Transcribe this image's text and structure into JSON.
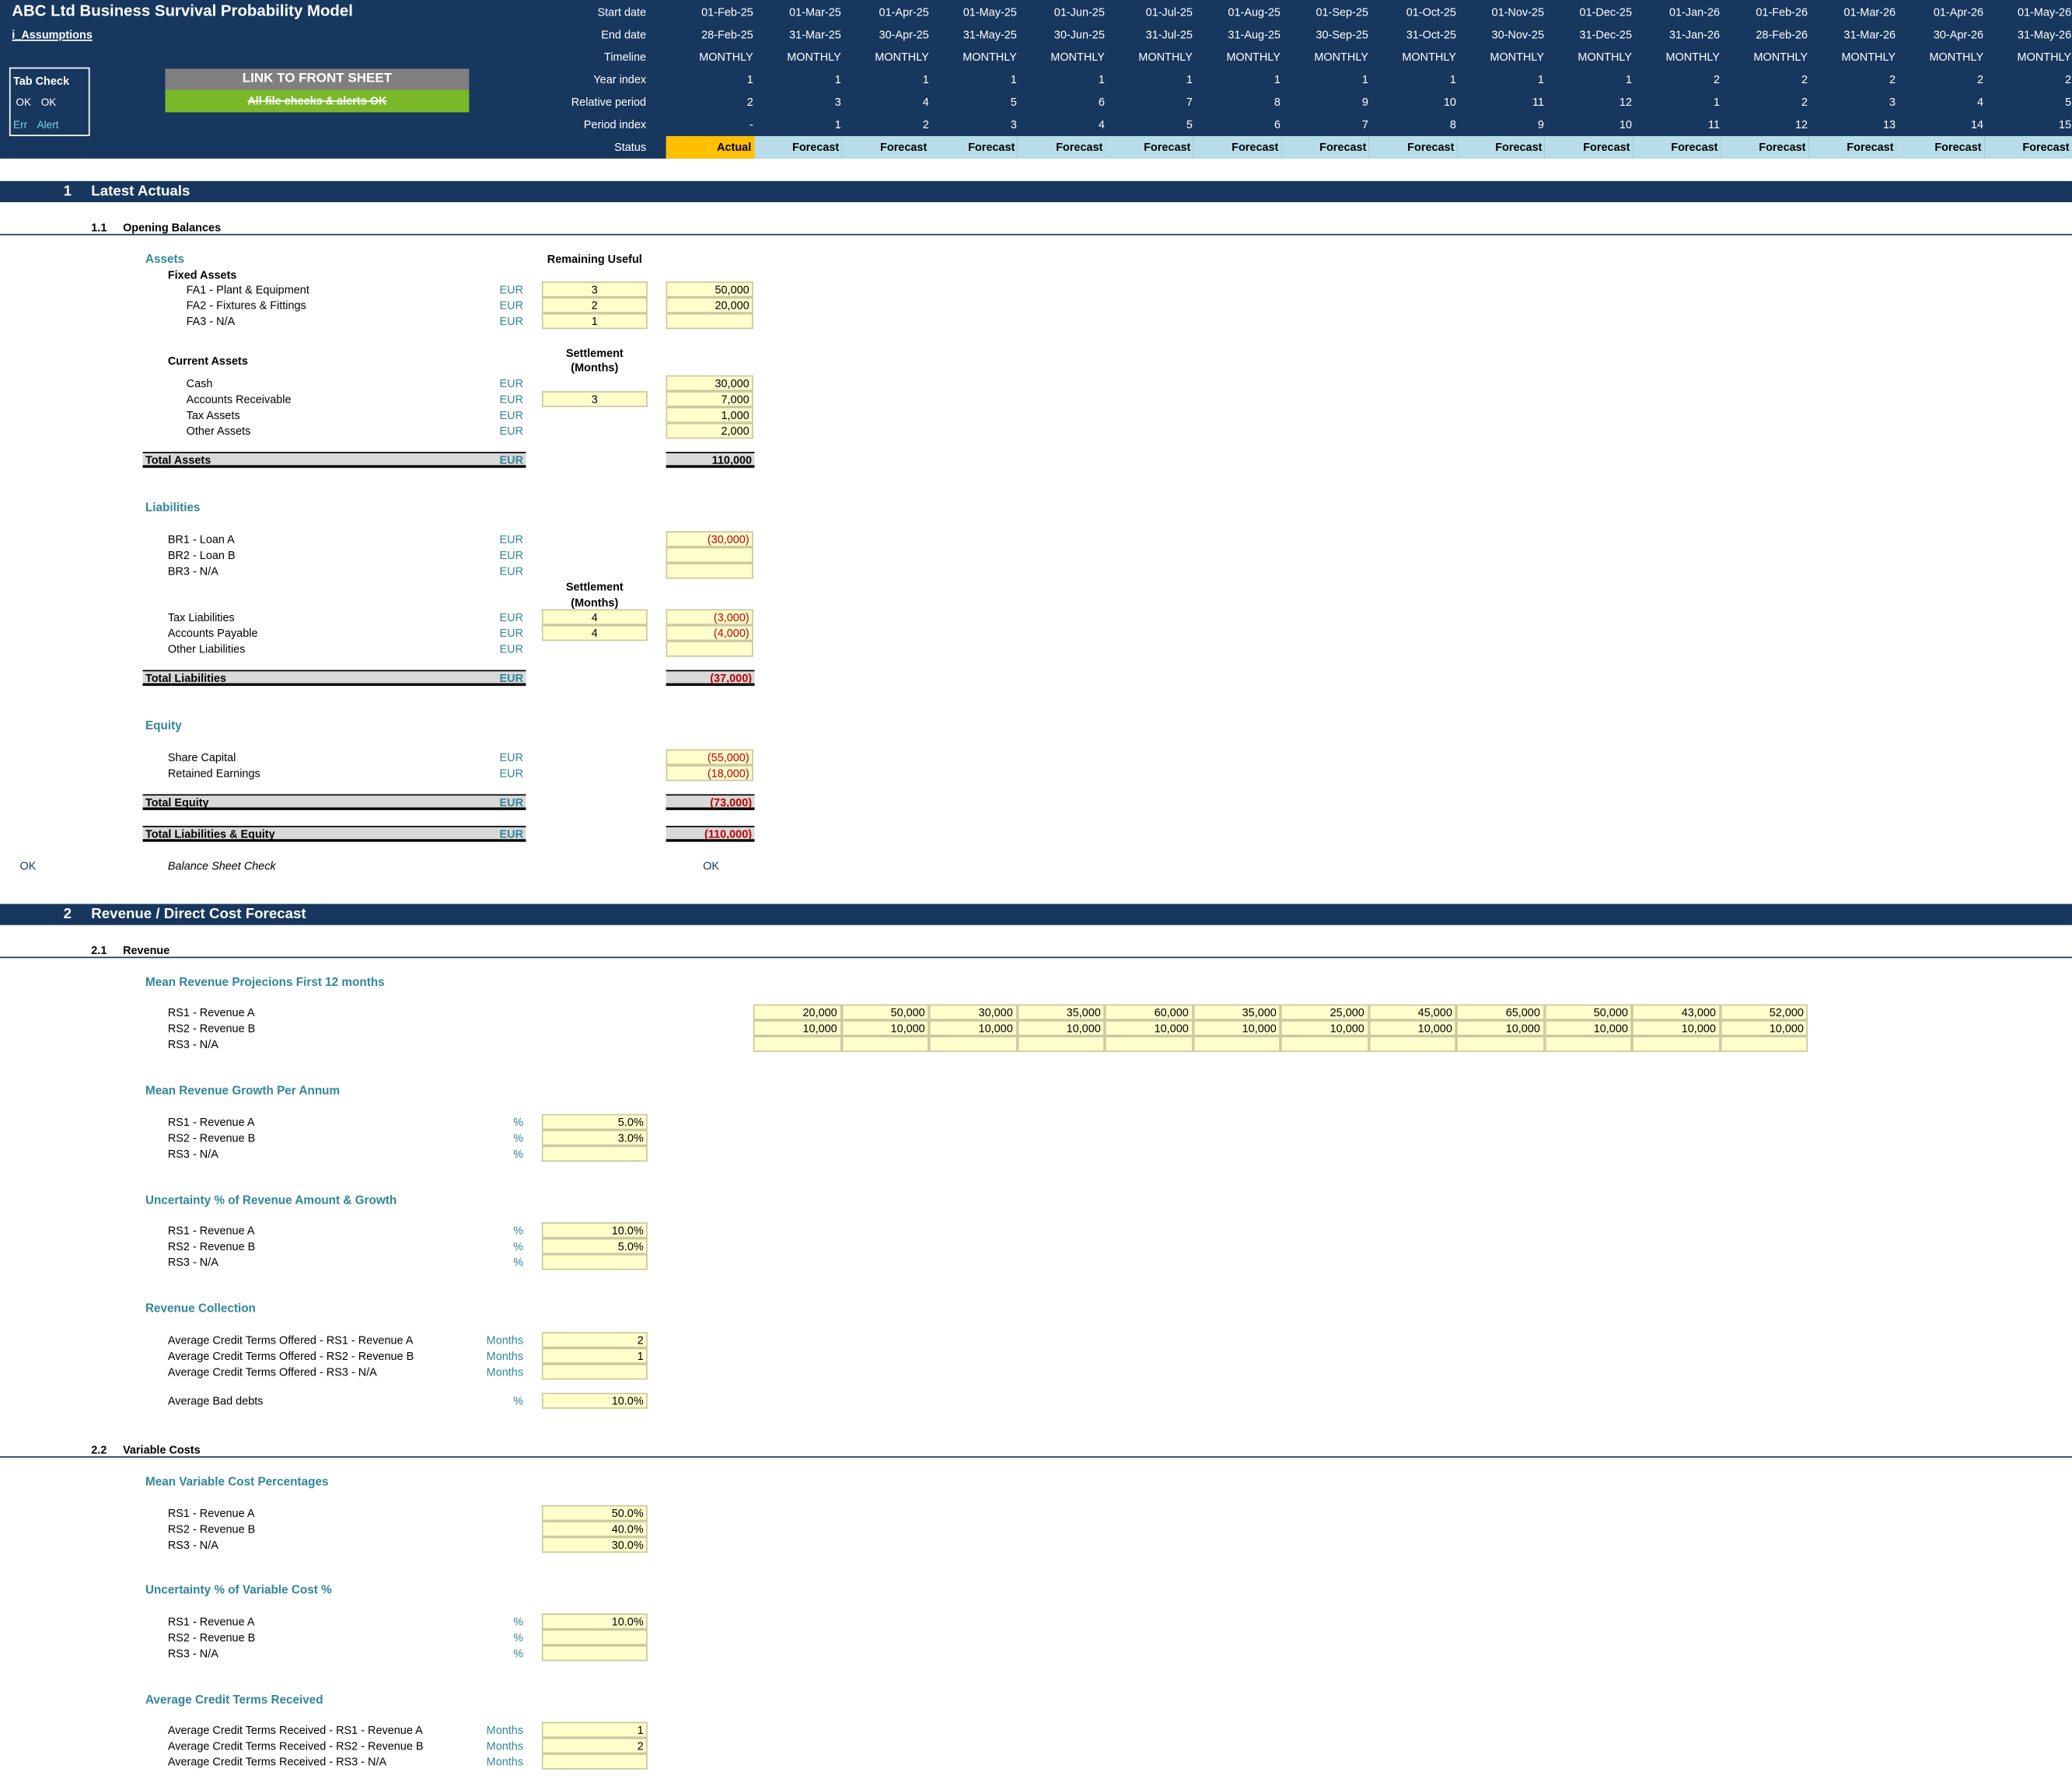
{
  "header": {
    "title": "ABC Ltd Business Survival Probability Model",
    "sheet": "i_Assumptions",
    "row_labels": [
      "Start date",
      "End date",
      "Timeline",
      "Year index",
      "Relative period",
      "Period index",
      "Status"
    ],
    "start_dates": [
      "01-Feb-25",
      "01-Mar-25",
      "01-Apr-25",
      "01-May-25",
      "01-Jun-25",
      "01-Jul-25",
      "01-Aug-25",
      "01-Sep-25",
      "01-Oct-25",
      "01-Nov-25",
      "01-Dec-25",
      "01-Jan-26",
      "01-Feb-26",
      "01-Mar-26",
      "01-Apr-26",
      "01-May-26"
    ],
    "end_dates": [
      "28-Feb-25",
      "31-Mar-25",
      "30-Apr-25",
      "31-May-25",
      "30-Jun-25",
      "31-Jul-25",
      "31-Aug-25",
      "30-Sep-25",
      "31-Oct-25",
      "30-Nov-25",
      "31-Dec-25",
      "31-Jan-26",
      "28-Feb-26",
      "31-Mar-26",
      "30-Apr-26",
      "31-May-26"
    ],
    "timeline": [
      "MONTHLY",
      "MONTHLY",
      "MONTHLY",
      "MONTHLY",
      "MONTHLY",
      "MONTHLY",
      "MONTHLY",
      "MONTHLY",
      "MONTHLY",
      "MONTHLY",
      "MONTHLY",
      "MONTHLY",
      "MONTHLY",
      "MONTHLY",
      "MONTHLY",
      "MONTHLY"
    ],
    "year_index": [
      "1",
      "1",
      "1",
      "1",
      "1",
      "1",
      "1",
      "1",
      "1",
      "1",
      "1",
      "2",
      "2",
      "2",
      "2",
      "2"
    ],
    "relative_period": [
      "2",
      "3",
      "4",
      "5",
      "6",
      "7",
      "8",
      "9",
      "10",
      "11",
      "12",
      "1",
      "2",
      "3",
      "4",
      "5"
    ],
    "period_index": [
      "-",
      "1",
      "2",
      "3",
      "4",
      "5",
      "6",
      "7",
      "8",
      "9",
      "10",
      "11",
      "12",
      "13",
      "14",
      "15"
    ],
    "status": [
      "Actual",
      "Forecast",
      "Forecast",
      "Forecast",
      "Forecast",
      "Forecast",
      "Forecast",
      "Forecast",
      "Forecast",
      "Forecast",
      "Forecast",
      "Forecast",
      "Forecast",
      "Forecast",
      "Forecast",
      "Forecast"
    ],
    "tab_check": {
      "title": "Tab Check",
      "ok1": "OK",
      "ok2": "OK",
      "err": "Err",
      "alert": "Alert"
    },
    "link_button": "LINK TO FRONT SHEET",
    "checks_status": "All file checks & alerts OK",
    "colors": {
      "header_bg": "#17375e",
      "actual": "#ffc000",
      "forecast": "#b7dee8",
      "input": "#ffffcc",
      "ok_green": "#7ab829"
    }
  },
  "s1": {
    "num": "1",
    "title": "Latest Actuals",
    "sub": {
      "num": "1.1",
      "title": "Opening Balances"
    },
    "assets": "Assets",
    "fixed": "Fixed Assets",
    "remaining_useful": "Remaining Useful",
    "fa": [
      {
        "label": "FA1 - Plant & Equipment",
        "unit": "EUR",
        "life": "3",
        "value": "50,000"
      },
      {
        "label": "FA2 - Fixtures & Fittings",
        "unit": "EUR",
        "life": "2",
        "value": "20,000"
      },
      {
        "label": "FA3 - N/A",
        "unit": "EUR",
        "life": "1",
        "value": ""
      }
    ],
    "current": "Current Assets",
    "settlement": "Settlement",
    "months": "(Months)",
    "ca": [
      {
        "label": "Cash",
        "unit": "EUR",
        "months": "",
        "value": "30,000"
      },
      {
        "label": "Accounts Receivable",
        "unit": "EUR",
        "months": "3",
        "value": "7,000"
      },
      {
        "label": "Tax Assets",
        "unit": "EUR",
        "months": "",
        "value": "1,000"
      },
      {
        "label": "Other Assets",
        "unit": "EUR",
        "months": "",
        "value": "2,000"
      }
    ],
    "total_assets": {
      "label": "Total Assets",
      "unit": "EUR",
      "value": "110,000"
    },
    "liabilities": "Liabilities",
    "br": [
      {
        "label": "BR1 - Loan A",
        "unit": "EUR",
        "value": "(30,000)"
      },
      {
        "label": "BR2 - Loan B",
        "unit": "EUR",
        "value": ""
      },
      {
        "label": "BR3 - N/A",
        "unit": "EUR",
        "value": ""
      }
    ],
    "ol": [
      {
        "label": "Tax Liabilities",
        "unit": "EUR",
        "months": "4",
        "value": "(3,000)"
      },
      {
        "label": "Accounts Payable",
        "unit": "EUR",
        "months": "4",
        "value": "(4,000)"
      },
      {
        "label": "Other Liabilities",
        "unit": "EUR",
        "months": "",
        "value": ""
      }
    ],
    "total_liab": {
      "label": "Total Liabilities",
      "unit": "EUR",
      "value": "(37,000)"
    },
    "equity": "Equity",
    "eq": [
      {
        "label": "Share Capital",
        "unit": "EUR",
        "value": "(55,000)"
      },
      {
        "label": "Retained Earnings",
        "unit": "EUR",
        "value": "(18,000)"
      }
    ],
    "total_eq": {
      "label": "Total Equity",
      "unit": "EUR",
      "value": "(73,000)"
    },
    "total_le": {
      "label": "Total Liabilities & Equity",
      "unit": "EUR",
      "value": "(110,000)"
    },
    "bs_check": {
      "ok_left": "OK",
      "label": "Balance Sheet Check",
      "ok_right": "OK"
    }
  },
  "s2": {
    "num": "2",
    "title": "Revenue / Direct Cost Forecast",
    "sub1": {
      "num": "2.1",
      "title": "Revenue"
    },
    "proj_title": "Mean Revenue Projecions First 12 months",
    "proj": [
      {
        "label": "RS1 - Revenue A",
        "values": [
          "20,000",
          "50,000",
          "30,000",
          "35,000",
          "60,000",
          "35,000",
          "25,000",
          "45,000",
          "65,000",
          "50,000",
          "43,000",
          "52,000"
        ]
      },
      {
        "label": "RS2 - Revenue B",
        "values": [
          "10,000",
          "10,000",
          "10,000",
          "10,000",
          "10,000",
          "10,000",
          "10,000",
          "10,000",
          "10,000",
          "10,000",
          "10,000",
          "10,000"
        ]
      },
      {
        "label": "RS3 - N/A",
        "values": [
          "",
          "",
          "",
          "",
          "",
          "",
          "",
          "",
          "",
          "",
          "",
          ""
        ]
      }
    ],
    "growth_title": "Mean Revenue Growth Per Annum",
    "growth": [
      {
        "label": "RS1 - Revenue A",
        "unit": "%",
        "value": "5.0%"
      },
      {
        "label": "RS2 - Revenue B",
        "unit": "%",
        "value": "3.0%"
      },
      {
        "label": "RS3 - N/A",
        "unit": "%",
        "value": ""
      }
    ],
    "unc_title": "Uncertainty % of Revenue Amount & Growth",
    "unc": [
      {
        "label": "RS1 - Revenue A",
        "unit": "%",
        "value": "10.0%"
      },
      {
        "label": "RS2 - Revenue B",
        "unit": "%",
        "value": "5.0%"
      },
      {
        "label": "RS3 - N/A",
        "unit": "%",
        "value": ""
      }
    ],
    "coll_title": "Revenue Collection",
    "coll": [
      {
        "label": "Average Credit Terms Offered - RS1 - Revenue A",
        "unit": "Months",
        "value": "2"
      },
      {
        "label": "Average Credit Terms Offered - RS2 - Revenue B",
        "unit": "Months",
        "value": "1"
      },
      {
        "label": "Average Credit Terms Offered - RS3 - N/A",
        "unit": "Months",
        "value": ""
      }
    ],
    "bad": {
      "label": "Average Bad debts",
      "unit": "%",
      "value": "10.0%"
    },
    "sub2": {
      "num": "2.2",
      "title": "Variable Costs"
    },
    "vc_title": "Mean Variable Cost Percentages",
    "vc": [
      {
        "label": "RS1 - Revenue A",
        "unit": "",
        "value": "50.0%"
      },
      {
        "label": "RS2 - Revenue B",
        "unit": "",
        "value": "40.0%"
      },
      {
        "label": "RS3 - N/A",
        "unit": "",
        "value": "30.0%"
      }
    ],
    "vcu_title": "Uncertainty % of Variable Cost %",
    "vcu": [
      {
        "label": "RS1 - Revenue A",
        "unit": "%",
        "value": "10.0%"
      },
      {
        "label": "RS2 - Revenue B",
        "unit": "%",
        "value": ""
      },
      {
        "label": "RS3 - N/A",
        "unit": "%",
        "value": ""
      }
    ],
    "ctr_title": "Average Credit Terms Received",
    "ctr": [
      {
        "label": "Average Credit Terms Received - RS1 - Revenue A",
        "unit": "Months",
        "value": "1"
      },
      {
        "label": "Average Credit Terms Received - RS2 - Revenue B",
        "unit": "Months",
        "value": "2"
      },
      {
        "label": "Average Credit Terms Received - RS3 - N/A",
        "unit": "Months",
        "value": ""
      }
    ]
  }
}
